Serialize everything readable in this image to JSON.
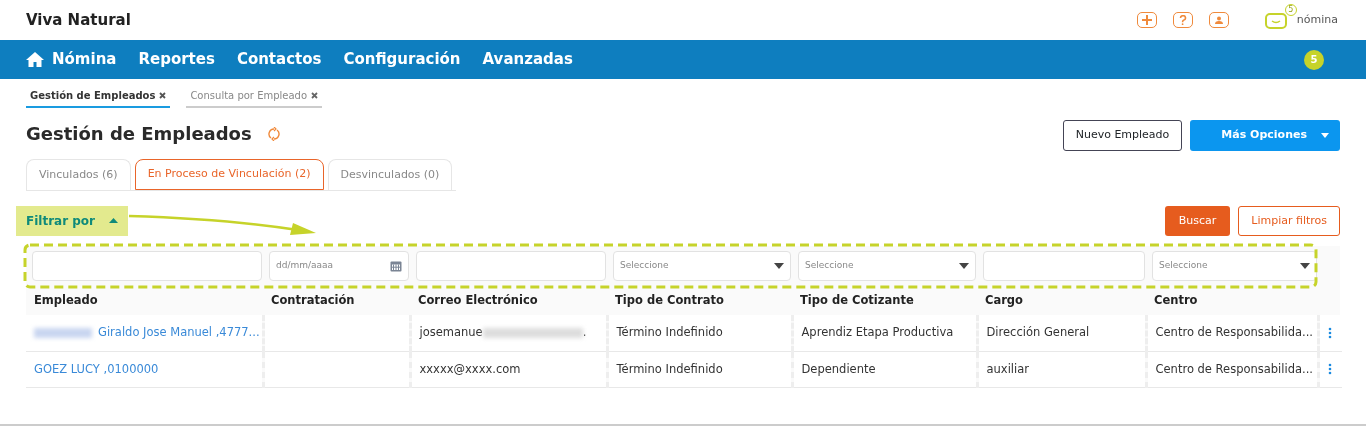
{
  "brand": "Viva Natural",
  "header_logo": {
    "text": "nómina",
    "badge": "5"
  },
  "nav": {
    "items": [
      {
        "label": "Nómina",
        "home": true
      },
      {
        "label": "Reportes",
        "home": false
      },
      {
        "label": "Contactos",
        "home": false
      },
      {
        "label": "Configuración",
        "home": false
      },
      {
        "label": "Avanzadas",
        "home": false
      }
    ],
    "badge": "5"
  },
  "page_tabs": [
    {
      "label": "Gestión de Empleados",
      "selected": true
    },
    {
      "label": "Consulta por Empleado",
      "selected": false
    }
  ],
  "title": "Gestión de Empleados",
  "actions": [
    {
      "label": "Nuevo Empleado",
      "kind": "outline"
    },
    {
      "label": "Más Opciones",
      "kind": "split"
    }
  ],
  "tabs": [
    {
      "label": "Vinculados (6)",
      "selected": false
    },
    {
      "label": "En Proceso de Vinculación (2)",
      "selected": true
    },
    {
      "label": "Desvinculados (0)",
      "selected": false
    }
  ],
  "filter": {
    "label": "Filtrar por",
    "expanded": true
  },
  "filter_buttons": [
    {
      "label": "Buscar",
      "kind": "solid"
    },
    {
      "label": "Limpiar filtros",
      "kind": "outline"
    }
  ],
  "filters": [
    {
      "kind": "text"
    },
    {
      "kind": "date",
      "placeholder": "dd/mm/aaaa"
    },
    {
      "kind": "text"
    },
    {
      "kind": "select",
      "placeholder": "Seleccione"
    },
    {
      "kind": "select",
      "placeholder": "Seleccione"
    },
    {
      "kind": "text"
    },
    {
      "kind": "select",
      "placeholder": "Seleccione"
    }
  ],
  "table": {
    "columns": [
      "Empleado",
      "Contratación",
      "Correo Electrónico",
      "Tipo de Contrato",
      "Tipo de Cotizante",
      "Cargo",
      "Centro"
    ],
    "rows": [
      {
        "cells": [
          {
            "text": "Giraldo Jose Manuel ,4777...",
            "kind": "link",
            "blurred_prefix": true
          },
          {
            "text": ""
          },
          {
            "text": "josemanue",
            "blurred_middle": true,
            "suffix": "."
          },
          {
            "text": "Término Indefinido"
          },
          {
            "text": "Aprendiz Etapa Productiva"
          },
          {
            "text": "Dirección General"
          },
          {
            "text": "Centro de Responsabilida..."
          }
        ]
      },
      {
        "cells": [
          {
            "text": "GOEZ LUCY ,0100000",
            "kind": "link"
          },
          {
            "text": ""
          },
          {
            "text": "xxxxx@xxxx.com"
          },
          {
            "text": "Término Indefinido"
          },
          {
            "text": "Dependiente"
          },
          {
            "text": "auxiliar"
          },
          {
            "text": "Centro de Responsabilida..."
          }
        ]
      }
    ]
  }
}
